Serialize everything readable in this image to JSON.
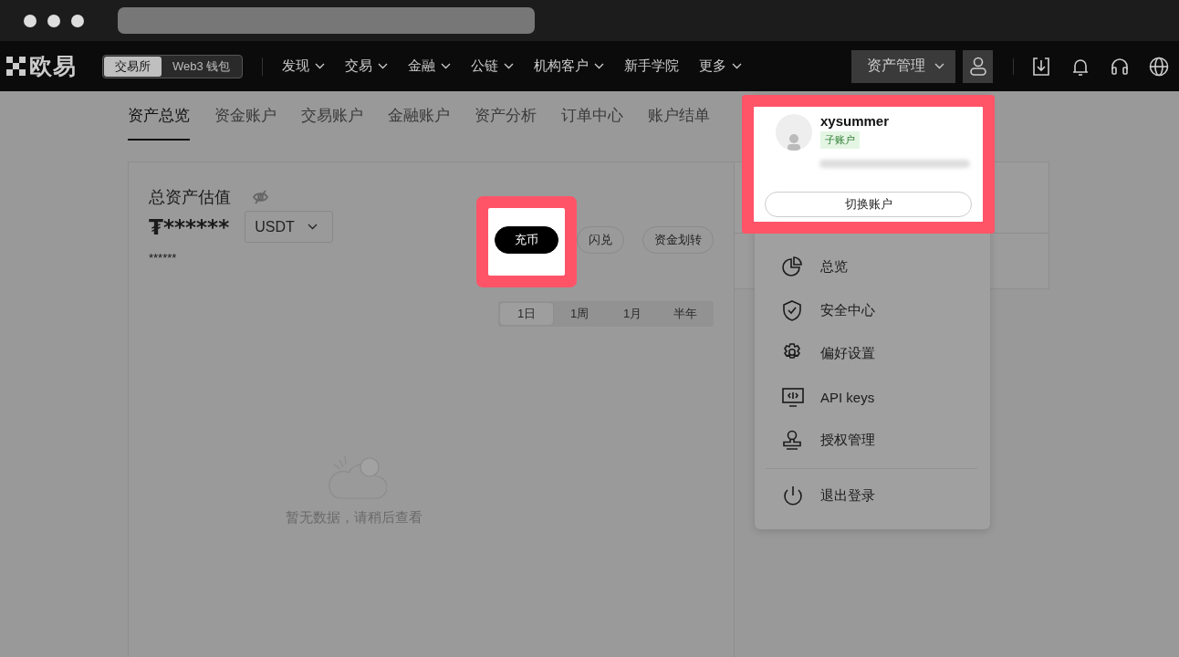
{
  "nav": {
    "logo": "欧易",
    "mode_toggle": [
      {
        "label": "交易所",
        "selected": true
      },
      {
        "label": "Web3 钱包",
        "selected": false
      }
    ],
    "menu": [
      {
        "label": "发现",
        "has_dropdown": true
      },
      {
        "label": "交易",
        "has_dropdown": true
      },
      {
        "label": "金融",
        "has_dropdown": true
      },
      {
        "label": "公链",
        "has_dropdown": true
      },
      {
        "label": "机构客户",
        "has_dropdown": true
      },
      {
        "label": "新手学院",
        "has_dropdown": false
      },
      {
        "label": "更多",
        "has_dropdown": true
      }
    ],
    "asset_button": "资产管理"
  },
  "sub_tabs": [
    {
      "label": "资产总览",
      "selected": true
    },
    {
      "label": "资金账户",
      "selected": false
    },
    {
      "label": "交易账户",
      "selected": false
    },
    {
      "label": "金融账户",
      "selected": false
    },
    {
      "label": "资产分析",
      "selected": false
    },
    {
      "label": "订单中心",
      "selected": false
    },
    {
      "label": "账户结单",
      "selected": false
    }
  ],
  "overview": {
    "title": "总资产估值",
    "balance": "₮******",
    "currency": "USDT",
    "sub_balance": "******",
    "actions": [
      {
        "label": "充币",
        "primary": true,
        "highlighted": true
      },
      {
        "label": "闪兑",
        "primary": false,
        "highlighted": false
      },
      {
        "label": "资金划转",
        "primary": false,
        "highlighted": false
      }
    ],
    "ranges": [
      {
        "label": "1日",
        "selected": true
      },
      {
        "label": "1周",
        "selected": false
      },
      {
        "label": "1月",
        "selected": false
      },
      {
        "label": "半年",
        "selected": false
      }
    ],
    "empty_message": "暂无数据，请稍后查看"
  },
  "user_menu": {
    "username": "xysummer",
    "badge": "子账户",
    "switch_button": "切换账户",
    "highlighted": true,
    "items": [
      {
        "label": "总览"
      },
      {
        "label": "安全中心"
      },
      {
        "label": "偏好设置"
      },
      {
        "label": "API keys"
      },
      {
        "label": "授权管理"
      }
    ],
    "logout": "退出登录"
  }
}
